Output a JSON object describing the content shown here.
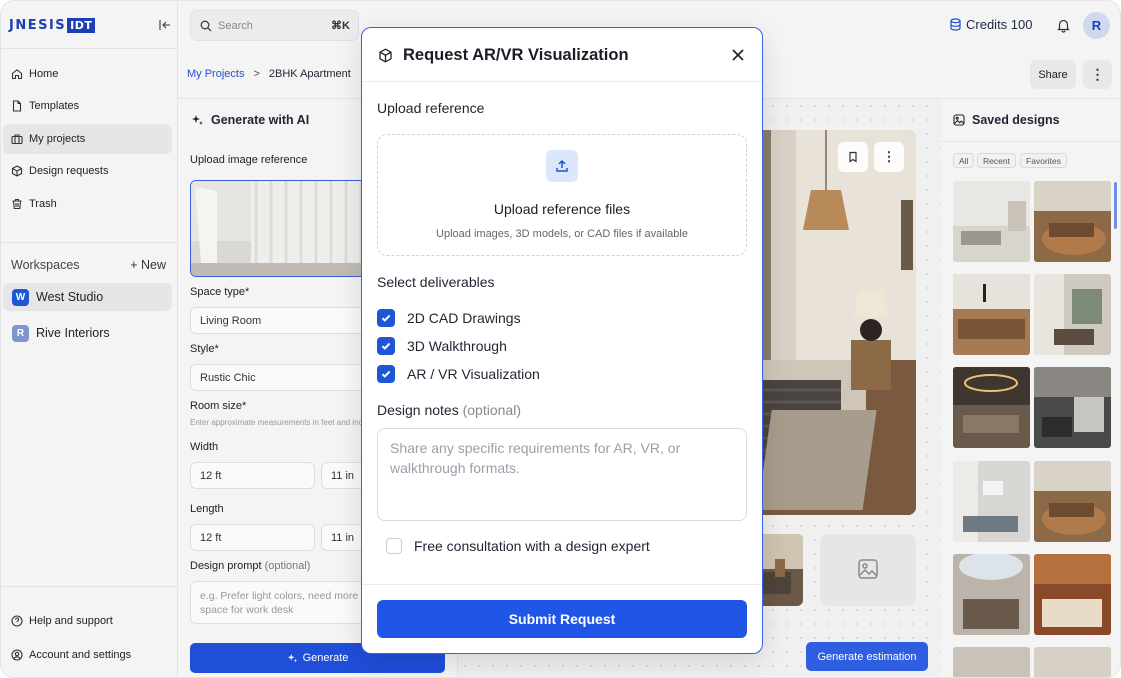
{
  "brand": {
    "word": "JNESIS",
    "box": "IDT"
  },
  "nav": [
    {
      "label": "Home",
      "icon": "home-icon"
    },
    {
      "label": "Templates",
      "icon": "file-icon"
    },
    {
      "label": "My projects",
      "icon": "briefcase-icon"
    },
    {
      "label": "Design requests",
      "icon": "cube-icon"
    },
    {
      "label": "Trash",
      "icon": "trash-icon"
    }
  ],
  "workspaces": {
    "heading": "Workspaces",
    "new_label": "+ New",
    "items": [
      {
        "initial": "W",
        "name": "West Studio",
        "color": "#1f56d6"
      },
      {
        "initial": "R",
        "name": "Rive Interiors",
        "color": "#7e96cf"
      }
    ]
  },
  "footer_nav": [
    {
      "label": "Help and support",
      "icon": "help-icon"
    },
    {
      "label": "Account and settings",
      "icon": "account-icon"
    }
  ],
  "topbar": {
    "search_placeholder": "Search",
    "search_shortcut": "⌘K",
    "credits": "Credits 100",
    "avatar_initial": "R"
  },
  "breadcrumb": {
    "root": "My Projects",
    "separator": ">",
    "current": "2BHK Apartment"
  },
  "actions": {
    "share": "Share"
  },
  "generate": {
    "title": "Generate with AI",
    "upload_label": "Upload image reference",
    "space_type_label": "Space type*",
    "space_type_value": "Living Room",
    "style_label": "Style*",
    "style_value": "Rustic Chic",
    "room_size_label": "Room size*",
    "room_size_hint": "Enter approximate measurements in feet and inches",
    "width_label": "Width",
    "width_ft": "12 ft",
    "width_in": "11 in",
    "length_label": "Length",
    "length_ft": "12 ft",
    "length_in": "11 in",
    "prompt_label": "Design prompt",
    "prompt_optional": "(optional)",
    "prompt_placeholder": "e.g. Prefer light colors, need more space for work desk",
    "button": "Generate"
  },
  "canvas": {
    "estimation_button": "Generate estimation"
  },
  "saved": {
    "title": "Saved designs",
    "filters": [
      "All",
      "Recent",
      "Favorites"
    ]
  },
  "modal": {
    "title": "Request AR/VR Visualization",
    "upload_heading": "Upload reference",
    "dropzone_title": "Upload reference files",
    "dropzone_sub": "Upload images, 3D models, or CAD files if available",
    "deliverables_heading": "Select deliverables",
    "deliverables": [
      {
        "label": "2D CAD Drawings",
        "checked": true
      },
      {
        "label": "3D Walkthrough",
        "checked": true
      },
      {
        "label": "AR / VR Visualization",
        "checked": true
      }
    ],
    "notes_heading": "Design notes",
    "notes_optional": "(optional)",
    "notes_placeholder": "Share any specific requirements for AR, VR, or walkthrough formats.",
    "consult_label": "Free consultation with a design expert",
    "consult_checked": false,
    "submit": "Submit Request"
  },
  "colors": {
    "accent": "#1f56e6",
    "brand": "#1c3fb5"
  }
}
